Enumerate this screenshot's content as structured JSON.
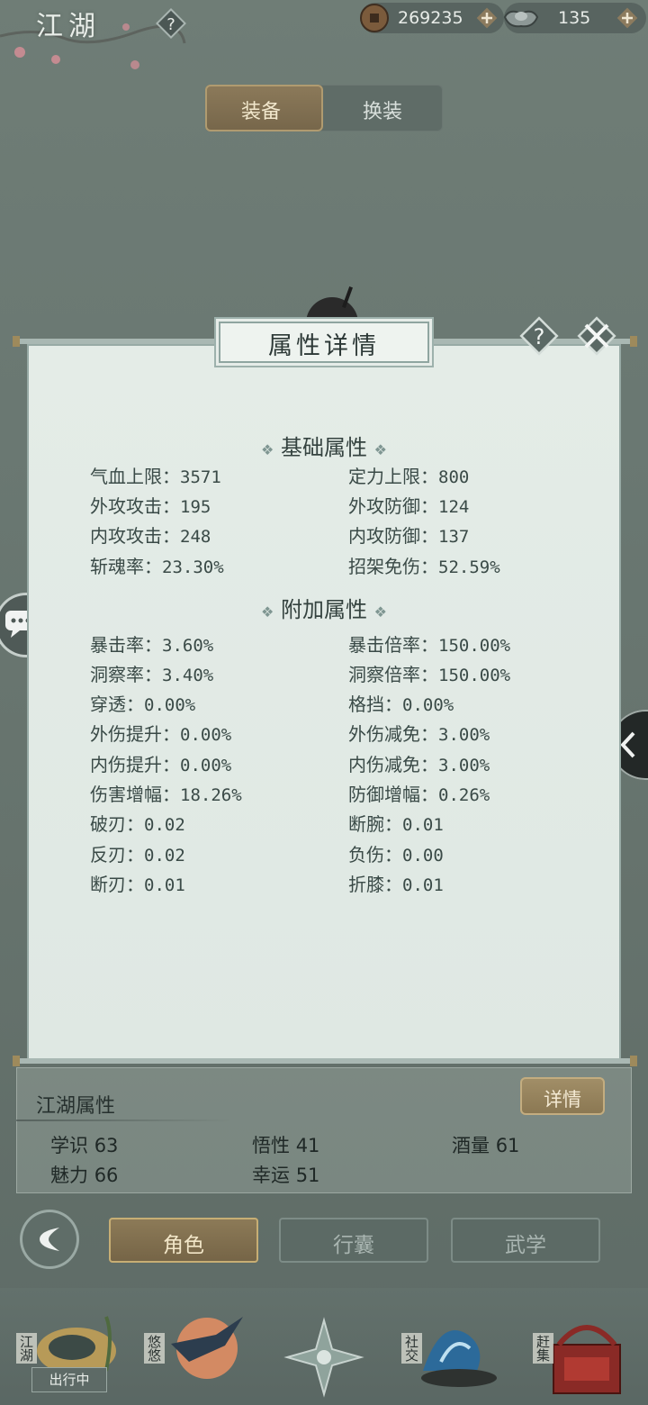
{
  "header": {
    "title": "江湖",
    "currency_coin": "269235",
    "currency_silver": "135"
  },
  "tabs": {
    "equip": "装备",
    "outfit": "换装",
    "active": "equip"
  },
  "modal": {
    "title": "属性详情",
    "base_section": "基础属性",
    "extra_section": "附加属性",
    "base_attrs": [
      {
        "label": "气血上限：",
        "value": "3571"
      },
      {
        "label": "定力上限：",
        "value": "800"
      },
      {
        "label": "外攻攻击：",
        "value": "195"
      },
      {
        "label": "外攻防御：",
        "value": "124"
      },
      {
        "label": "内攻攻击：",
        "value": "248"
      },
      {
        "label": "内攻防御：",
        "value": "137"
      },
      {
        "label": "斩魂率：",
        "value": "23.30%"
      },
      {
        "label": "招架免伤：",
        "value": "52.59%"
      }
    ],
    "extra_attrs": [
      {
        "label": "暴击率：",
        "value": "3.60%"
      },
      {
        "label": "暴击倍率：",
        "value": "150.00%"
      },
      {
        "label": "洞察率：",
        "value": "3.40%"
      },
      {
        "label": "洞察倍率：",
        "value": "150.00%"
      },
      {
        "label": "穿透：",
        "value": "0.00%"
      },
      {
        "label": "格挡：",
        "value": "0.00%"
      },
      {
        "label": "外伤提升：",
        "value": "0.00%"
      },
      {
        "label": "外伤减免：",
        "value": "3.00%"
      },
      {
        "label": "内伤提升：",
        "value": "0.00%"
      },
      {
        "label": "内伤减免：",
        "value": "3.00%"
      },
      {
        "label": "伤害增幅：",
        "value": "18.26%"
      },
      {
        "label": "防御增幅：",
        "value": "0.26%"
      },
      {
        "label": "破刃：",
        "value": "0.02"
      },
      {
        "label": "断腕：",
        "value": "0.01"
      },
      {
        "label": "反刃：",
        "value": "0.02"
      },
      {
        "label": "负伤：",
        "value": "0.00"
      },
      {
        "label": "断刃：",
        "value": "0.01"
      },
      {
        "label": "折膝：",
        "value": "0.01"
      }
    ]
  },
  "jianghu": {
    "title": "江湖属性",
    "details_label": "详情",
    "stats": [
      {
        "label": "学识",
        "value": "63"
      },
      {
        "label": "悟性",
        "value": "41"
      },
      {
        "label": "酒量",
        "value": "61"
      },
      {
        "label": "魅力",
        "value": "66"
      },
      {
        "label": "幸运",
        "value": "51"
      }
    ]
  },
  "nav": {
    "role": "角色",
    "bag": "行囊",
    "martial": "武学",
    "active": "role"
  },
  "bottom_bar": {
    "jianghu": "江湖",
    "leisure": "悠悠",
    "social": "社交",
    "market": "赶集",
    "status": "出行中"
  }
}
